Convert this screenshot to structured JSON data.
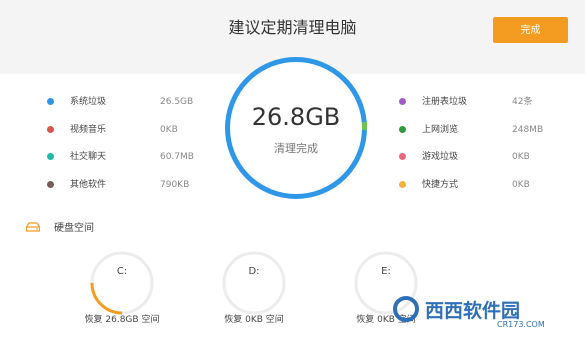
{
  "header": {
    "title": "建议定期清理电脑",
    "done_label": "完成"
  },
  "summary": {
    "total_size": "26.8GB",
    "status": "清理完成"
  },
  "categories_left": [
    {
      "label": "系统垃圾",
      "size": "26.5GB",
      "color": "#2f96e6"
    },
    {
      "label": "视频音乐",
      "size": "0KB",
      "color": "#d9534f"
    },
    {
      "label": "社交聊天",
      "size": "60.7MB",
      "color": "#1fb8a9"
    },
    {
      "label": "其他软件",
      "size": "790KB",
      "color": "#7a5b5b"
    }
  ],
  "categories_right": [
    {
      "label": "注册表垃圾",
      "size": "42条",
      "color": "#a35bc6"
    },
    {
      "label": "上网浏览",
      "size": "248MB",
      "color": "#2f9a3b"
    },
    {
      "label": "游戏垃圾",
      "size": "0KB",
      "color": "#e6667a"
    },
    {
      "label": "快捷方式",
      "size": "0KB",
      "color": "#f2b33a"
    }
  ],
  "disk": {
    "title": "硬盘空间",
    "drives": [
      {
        "letter": "C:",
        "recover": "恢复 26.8GB 空间",
        "fill": 0.25
      },
      {
        "letter": "D:",
        "recover": "恢复 0KB 空间",
        "fill": 0
      },
      {
        "letter": "E:",
        "recover": "恢复 0KB 空间",
        "fill": 0
      }
    ]
  },
  "watermark": {
    "brand": "西西软件园",
    "url": "CR173.COM"
  },
  "colors": {
    "accent_orange": "#f39c21",
    "ring_blue": "#2e97e8",
    "ring_green": "#6fc24f"
  }
}
